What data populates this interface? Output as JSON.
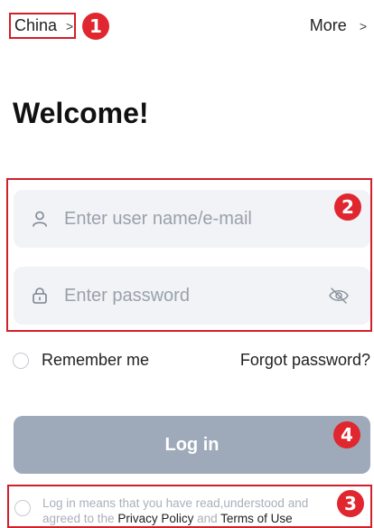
{
  "top_bar": {
    "region_label": "China",
    "region_chevron": ">",
    "more_label": "More",
    "more_chevron": ">"
  },
  "badges": {
    "one": "1",
    "two": "2",
    "three": "3",
    "four": "4"
  },
  "title": "Welcome!",
  "form": {
    "username_placeholder": "Enter user name/e-mail",
    "username_value": "",
    "password_placeholder": "Enter password",
    "password_value": "",
    "remember_label": "Remember me",
    "forgot_label": "Forgot password?",
    "login_label": "Log in"
  },
  "consent": {
    "prefix": "Log in means that you have read,understood and agreed to the ",
    "privacy": "Privacy Policy",
    "and": " and ",
    "terms": "Terms of Use"
  },
  "colors": {
    "accent_red": "#e0262e",
    "field_bg": "#f1f3f6",
    "button_disabled": "#9ea9ba"
  }
}
